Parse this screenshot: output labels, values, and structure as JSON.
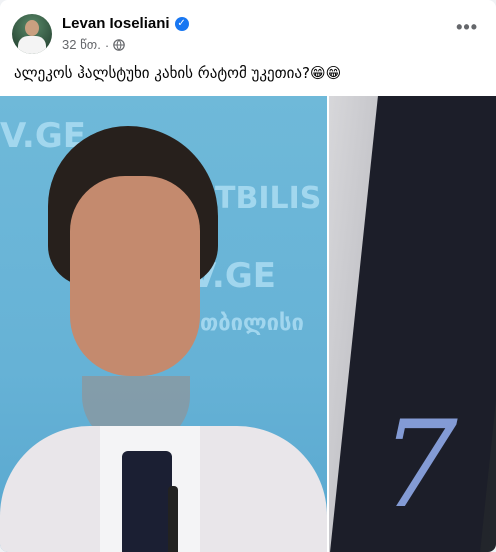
{
  "post": {
    "author": "Levan Ioseliani",
    "time": "32 წთ.",
    "privacy_icon": "globe-icon",
    "verified_icon": "verified-badge-icon",
    "more_icon": "more-options-icon",
    "text": "ალეკოს ჰალსტუხი კახის რატომ უკეთია?😁😁"
  },
  "photo_left": {
    "bg_text_1": "V.GE",
    "bg_text_2": "TBILIS",
    "bg_text_3": "V.GE",
    "bg_text_4": "თბილისი"
  },
  "photo_right": {
    "symbol": "7"
  },
  "colors": {
    "accent": "#1877f2",
    "meta": "#65676b",
    "text": "#050505"
  }
}
